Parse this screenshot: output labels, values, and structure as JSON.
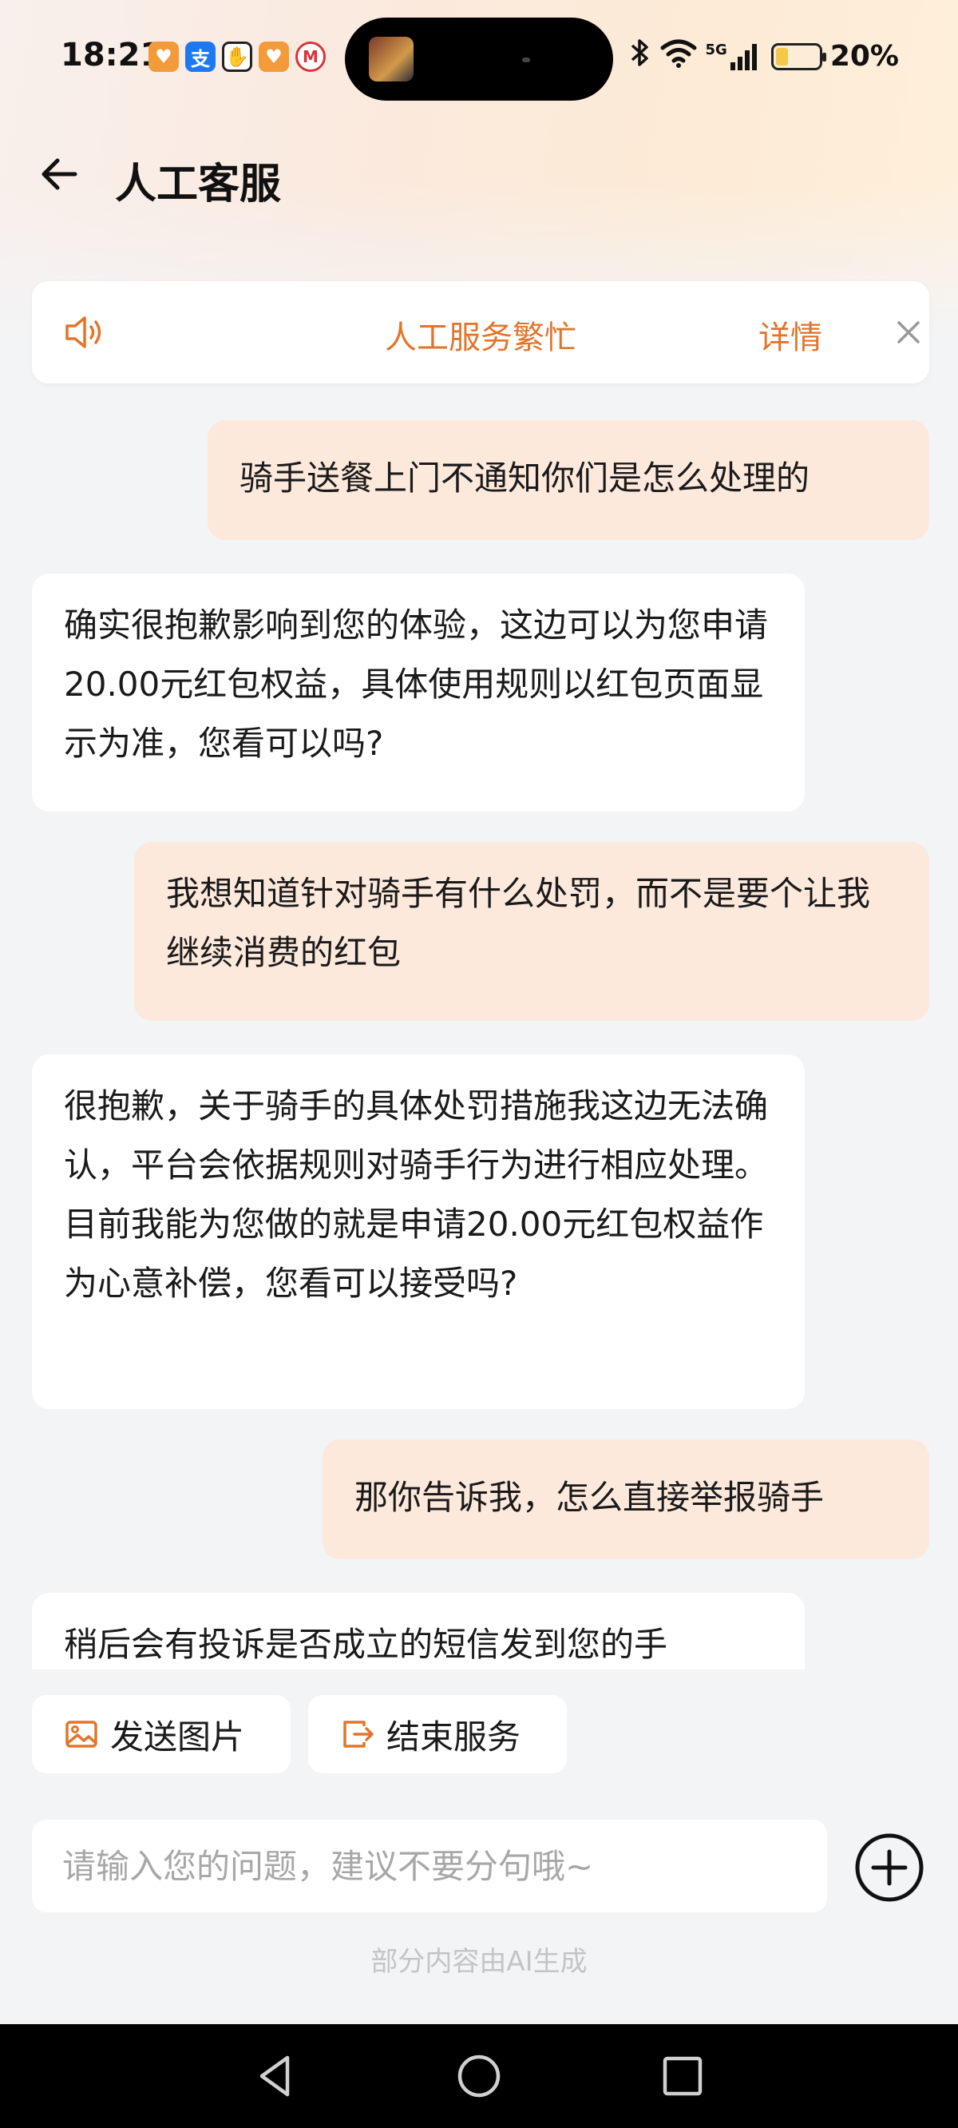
{
  "status_bar": {
    "time": "18:21",
    "signal_label": "5G",
    "battery": "20%"
  },
  "header": {
    "title": "人工客服"
  },
  "notice": {
    "text": "人工服务繁忙",
    "detail_label": "详情"
  },
  "messages": [
    {
      "role": "user",
      "text": "骑手送餐上门不通知你们是怎么处理的"
    },
    {
      "role": "agent",
      "text": "确实很抱歉影响到您的体验，这边可以为您申请20.00元红包权益，具体使用规则以红包页面显示为准，您看可以吗?"
    },
    {
      "role": "user",
      "text": "我想知道针对骑手有什么处罚，而不是要个让我继续消费的红包"
    },
    {
      "role": "agent",
      "text": "很抱歉，关于骑手的具体处罚措施我这边无法确认，平台会依据规则对骑手行为进行相应处理。目前我能为您做的就是申请20.00元红包权益作为心意补偿，您看可以接受吗?"
    },
    {
      "role": "user",
      "text": "那你告诉我，怎么直接举报骑手"
    },
    {
      "role": "agent",
      "text": "稍后会有投诉是否成立的短信发到您的手"
    }
  ],
  "quick_actions": {
    "send_image": "发送图片",
    "end_service": "结束服务"
  },
  "input": {
    "placeholder": "请输入您的问题，建议不要分句哦~",
    "value": ""
  },
  "footer_note": "部分内容由AI生成",
  "colors": {
    "accent": "#e2752b",
    "user_bubble": "#fde9dc",
    "agent_bubble": "#ffffff",
    "background": "#f3f4f6"
  }
}
